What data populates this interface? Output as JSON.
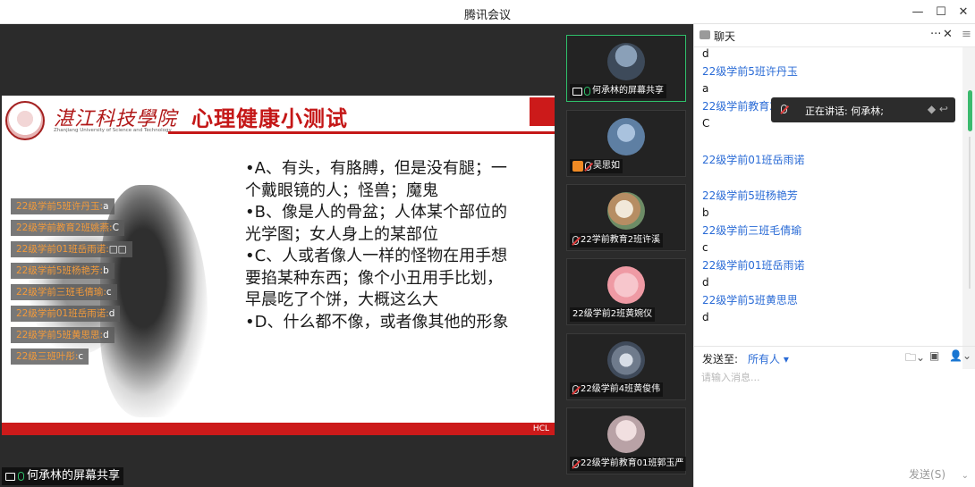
{
  "window": {
    "title": "腾讯会议",
    "minimize": "—",
    "maximize": "☐",
    "close": "✕"
  },
  "slide": {
    "logo_text": "湛江科技學院",
    "logo_sub": "Zhanjiang University of Science and Technology",
    "title": "心理健康小测试",
    "options": [
      "•A、有头，有胳膊，但是没有腿；一个戴眼镜的人；怪兽；魔鬼",
      "•B、像是人的骨盆；人体某个部位的光学图；女人身上的某部位",
      "•C、人或者像人一样的怪物在用手想要掐某种东西；像个小丑用手比划，早晨吃了个饼，大概这么大",
      "•D、什么都不像，或者像其他的形象"
    ],
    "footer": "HCL"
  },
  "danmaku": [
    {
      "name": "22级学前5班许丹玉:",
      "answer": "a"
    },
    {
      "name": "22级学前教育2班姚燕:",
      "answer": "C"
    },
    {
      "name": "22级学前01班岳雨诺:",
      "answer": "□□"
    },
    {
      "name": "22级学前5班杨艳芳:",
      "answer": "b"
    },
    {
      "name": "22级学前三班毛倩瑜:",
      "answer": "c"
    },
    {
      "name": "22级学前01班岳雨诺:",
      "answer": "d"
    },
    {
      "name": "22级学前5班黄思思:",
      "answer": "d"
    },
    {
      "name": "22级三班叶彤:",
      "answer": "c"
    }
  ],
  "share_label": "何承林的屏幕共享",
  "participants": [
    {
      "name": "何承林的屏幕共享",
      "avatar_color": "#5a6f86"
    },
    {
      "name": "吴思如",
      "avatar_color": "#6f8fb4"
    },
    {
      "name": "22学前教育2班许溪",
      "avatar_color": "#c9b39a"
    },
    {
      "name": "22级学前2班黄婉仪",
      "avatar_color": "#f3b2b8"
    },
    {
      "name": "22级学前4班黄俊伟",
      "avatar_color": "#7c8a9e"
    },
    {
      "name": "22级学前教育01班郭玉严",
      "avatar_color": "#d9c4c8"
    }
  ],
  "chat": {
    "title": "聊天",
    "more": "···",
    "close": "✕",
    "menu": "≡",
    "messages": [
      {
        "kind": "text",
        "value": "d"
      },
      {
        "kind": "sender",
        "value": "22级学前5班许丹玉"
      },
      {
        "kind": "text",
        "value": "a"
      },
      {
        "kind": "sender",
        "value": "22级学前教育2"
      },
      {
        "kind": "text",
        "value": "C"
      },
      {
        "kind": "sender",
        "value": "22级学前01班岳雨诺"
      },
      {
        "kind": "sender",
        "value": "22级学前5班杨艳芳"
      },
      {
        "kind": "text",
        "value": "b"
      },
      {
        "kind": "sender",
        "value": "22级学前三班毛倩瑜"
      },
      {
        "kind": "text",
        "value": "c"
      },
      {
        "kind": "sender",
        "value": "22级学前01班岳雨诺"
      },
      {
        "kind": "text",
        "value": "d"
      },
      {
        "kind": "sender",
        "value": "22级学前5班黄思思"
      },
      {
        "kind": "text",
        "value": "d"
      }
    ],
    "speaking": "正在讲话: 何承林;",
    "send_to_label": "发送至:",
    "send_to_value": "所有人 ▾",
    "placeholder": "请输入消息...",
    "send_button": "发送(S)",
    "send_arrow": "⌄"
  }
}
